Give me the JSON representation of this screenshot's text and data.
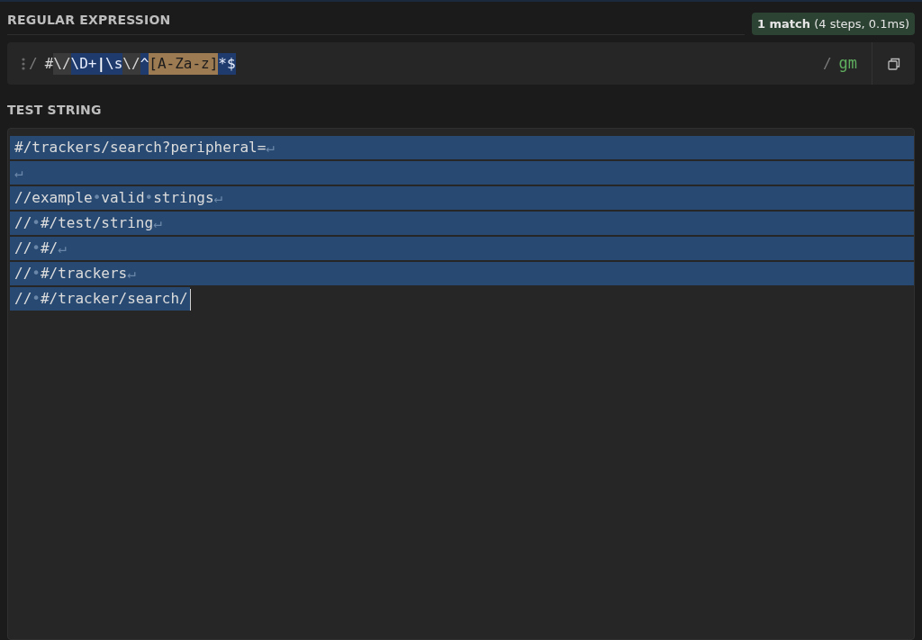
{
  "regex_section": {
    "title": "REGULAR EXPRESSION",
    "match_info": {
      "count": "1 match",
      "detail": "(4 steps, 0.1ms)"
    },
    "delimiter_open": "/",
    "tokens": [
      {
        "text": "#",
        "kind": "plain"
      },
      {
        "text": "\\/",
        "kind": "escape"
      },
      {
        "text": "\\D+",
        "kind": "group"
      },
      {
        "text": "|",
        "kind": "alternation"
      },
      {
        "text": "\\s",
        "kind": "group"
      },
      {
        "text": "\\/",
        "kind": "escape"
      },
      {
        "text": "^",
        "kind": "group"
      },
      {
        "text": "[A-Za-z]",
        "kind": "charset"
      },
      {
        "text": "*$",
        "kind": "group"
      }
    ],
    "delimiter_close": "/",
    "flags": "gm"
  },
  "test_section": {
    "title": "TEST STRING",
    "lines": [
      {
        "full_width": true,
        "segments": [
          {
            "text": "#/trackers/search?peripheral=",
            "kind": "text"
          },
          {
            "text": "↵",
            "kind": "marker"
          }
        ]
      },
      {
        "full_width": true,
        "segments": [
          {
            "text": "↵",
            "kind": "marker"
          }
        ]
      },
      {
        "full_width": true,
        "segments": [
          {
            "text": "//example",
            "kind": "text"
          },
          {
            "text": "•",
            "kind": "marker"
          },
          {
            "text": "valid",
            "kind": "text"
          },
          {
            "text": "•",
            "kind": "marker"
          },
          {
            "text": "strings",
            "kind": "text"
          },
          {
            "text": "↵",
            "kind": "marker"
          }
        ]
      },
      {
        "full_width": true,
        "segments": [
          {
            "text": "//",
            "kind": "text"
          },
          {
            "text": "•",
            "kind": "marker"
          },
          {
            "text": "#/test/string",
            "kind": "text"
          },
          {
            "text": "↵",
            "kind": "marker"
          }
        ]
      },
      {
        "full_width": true,
        "segments": [
          {
            "text": "//",
            "kind": "text"
          },
          {
            "text": "•",
            "kind": "marker"
          },
          {
            "text": "#/",
            "kind": "text"
          },
          {
            "text": "↵",
            "kind": "marker"
          }
        ]
      },
      {
        "full_width": true,
        "segments": [
          {
            "text": "//",
            "kind": "text"
          },
          {
            "text": "•",
            "kind": "marker"
          },
          {
            "text": "#/trackers",
            "kind": "text"
          },
          {
            "text": "↵",
            "kind": "marker"
          }
        ]
      },
      {
        "full_width": false,
        "segments": [
          {
            "text": "//",
            "kind": "text"
          },
          {
            "text": "•",
            "kind": "marker"
          },
          {
            "text": "#/tracker/search/",
            "kind": "text"
          }
        ]
      }
    ]
  }
}
